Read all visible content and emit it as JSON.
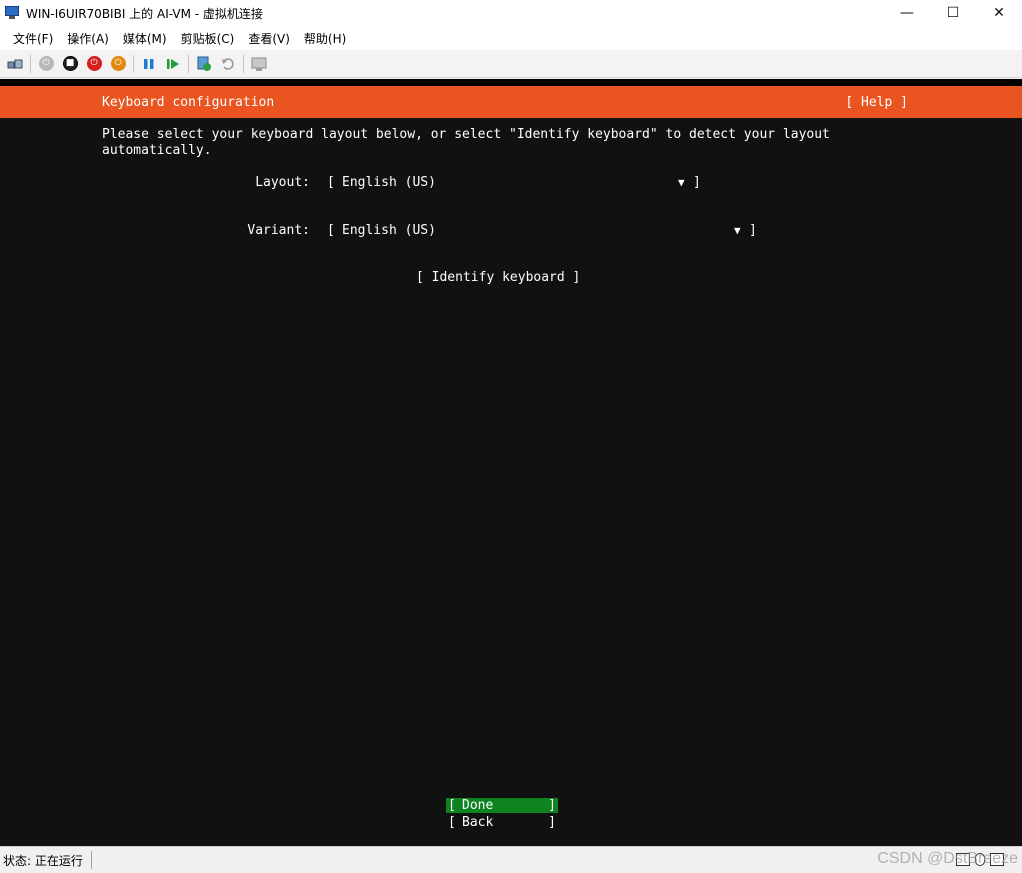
{
  "window": {
    "title": "WIN-I6UIR70BIBI 上的 AI-VM - 虚拟机连接",
    "minimize": "—",
    "maximize": "☐",
    "close": "✕"
  },
  "menu": {
    "items": [
      "文件(F)",
      "操作(A)",
      "媒体(M)",
      "剪贴板(C)",
      "查看(V)",
      "帮助(H)"
    ]
  },
  "toolbar": {
    "icons": [
      "ctrl-alt-del-icon",
      "start-icon",
      "turn-off-icon",
      "shutdown-icon",
      "save-icon",
      "pause-icon",
      "resume-icon",
      "checkpoint-icon",
      "revert-icon",
      "enhanced-session-icon"
    ]
  },
  "installer": {
    "header_title": "Keyboard configuration",
    "help": "[ Help ]",
    "intro_line1": "Please select your keyboard layout below, or select \"Identify keyboard\" to detect your layout",
    "intro_line2": "automatically.",
    "layout_label": "Layout:",
    "layout_value": "English (US)",
    "variant_label": "Variant:",
    "variant_value": "English (US)",
    "identify_button": "[ Identify keyboard ]",
    "done_label": "Done",
    "back_label": "Back",
    "bracket_open": "[",
    "bracket_close": "]",
    "dropdown_arrow": "▼"
  },
  "status": {
    "text": "状态: 正在运行",
    "watermark": "CSDN @DstBreeze"
  },
  "colors": {
    "header": "#e95420",
    "selected_button": "#0e8420",
    "screen_bg": "#111111"
  }
}
